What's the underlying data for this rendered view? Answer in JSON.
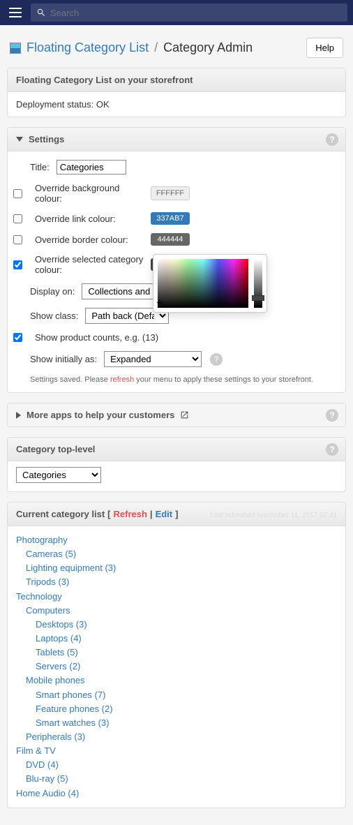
{
  "topbar": {
    "search_placeholder": "Search"
  },
  "breadcrumb": {
    "app": "Floating Category List",
    "sep": "/",
    "current": "Category Admin",
    "help": "Help"
  },
  "storefront": {
    "header": "Floating Category List on your storefront",
    "status_label": "Deployment status: ",
    "status_value": "OK"
  },
  "settings": {
    "header": "Settings",
    "title_label": "Title:",
    "title_value": "Categories",
    "bg_label": "Override background colour:",
    "bg_value": "FFFFFF",
    "link_label": "Override link colour:",
    "link_value": "337AB7",
    "border_label": "Override border colour:",
    "border_value": "444444",
    "selected_label": "Override selected category colour:",
    "selected_value": "444444",
    "displayon_label": "Display on:",
    "displayon_value": "Collections and linked pages",
    "showclass_label": "Show class:",
    "showclass_value": "Path back (Default)",
    "counts_label": "Show product counts, e.g. (13)",
    "showinit_label": "Show initially as:",
    "showinit_value": "Expanded",
    "save_msg_1": "Settings saved. Please ",
    "save_msg_refresh": "refresh",
    "save_msg_2": " your menu to apply these settings to your storefront."
  },
  "moreapps": {
    "header": "More apps to help your customers"
  },
  "toplevel": {
    "header": "Category top-level",
    "value": "Categories"
  },
  "catlist": {
    "header": "Current category list",
    "bracket_open": " [ ",
    "refresh": "Refresh",
    "pipe": " | ",
    "edit": "Edit",
    "bracket_close": " ]",
    "ts": "Last refreshed November 11, 2017 07:41",
    "tree": [
      {
        "label": "Photography",
        "children": [
          {
            "label": "Cameras (5)"
          },
          {
            "label": "Lighting equipment (3)"
          },
          {
            "label": "Tripods (3)"
          }
        ]
      },
      {
        "label": "Technology",
        "children": [
          {
            "label": "Computers",
            "children": [
              {
                "label": "Desktops (3)"
              },
              {
                "label": "Laptops (4)"
              },
              {
                "label": "Tablets (5)"
              },
              {
                "label": "Servers (2)"
              }
            ]
          },
          {
            "label": "Mobile phones",
            "children": [
              {
                "label": "Smart phones (7)"
              },
              {
                "label": "Feature phones (2)"
              },
              {
                "label": "Smart watches (3)"
              }
            ]
          },
          {
            "label": "Peripherals (3)"
          }
        ]
      },
      {
        "label": "Film & TV",
        "children": [
          {
            "label": "DVD (4)"
          },
          {
            "label": "Blu-ray (5)"
          }
        ]
      },
      {
        "label": "Home Audio (4)"
      }
    ]
  },
  "colors": {
    "link": "#337ab7",
    "danger": "#d9534f",
    "fffff": "#eeeeee",
    "border444": "#444444",
    "sel444": "#444444",
    "c337ab7": "#337ab7"
  }
}
